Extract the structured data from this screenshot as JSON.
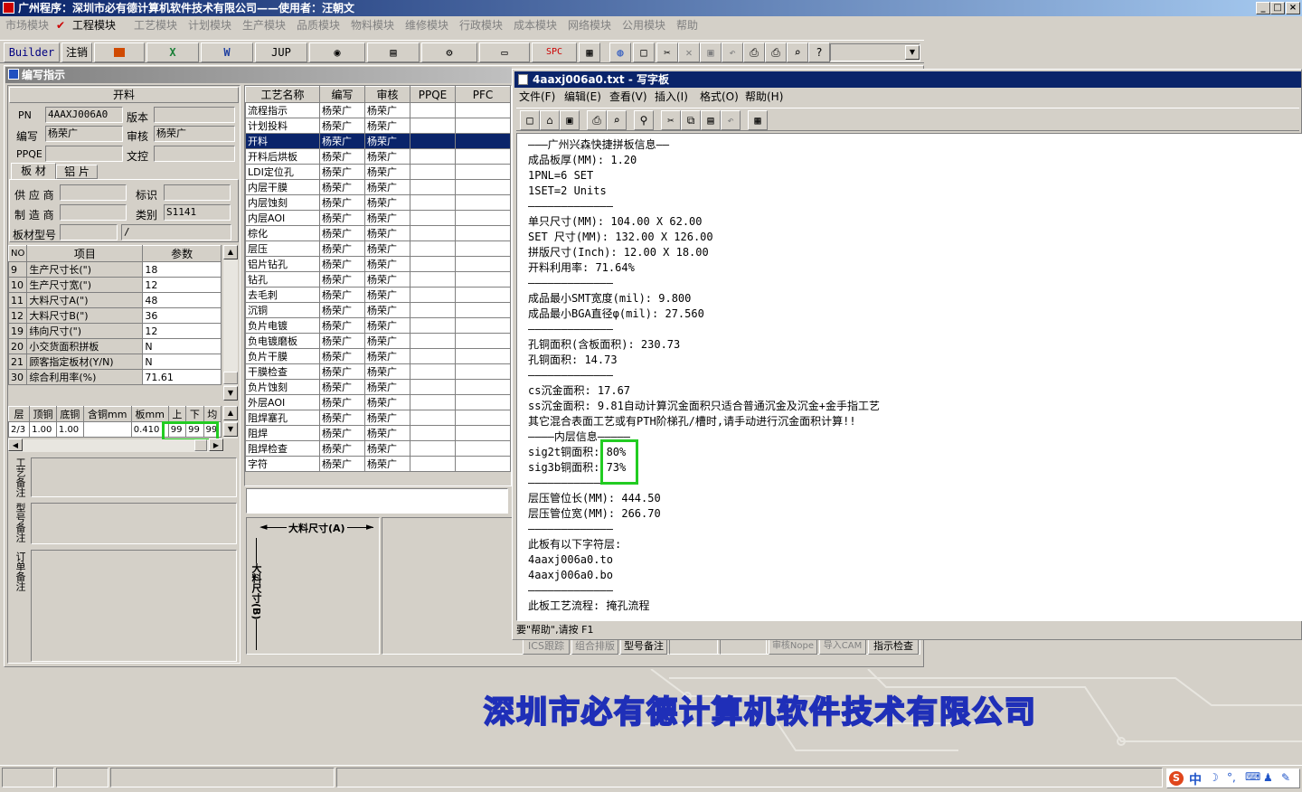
{
  "app": {
    "title": "广州程序：深圳市必有德计算机软件技术有限公司——使用者：汪朝文",
    "menu": [
      "市场模块",
      "工程模块",
      "工艺模块",
      "计划模块",
      "生产模块",
      "品质模块",
      "物料模块",
      "维修模块",
      "行政模块",
      "成本模块",
      "网络模块",
      "公用模块",
      "帮助"
    ],
    "toolbar": {
      "builder": "Builder",
      "logout": "注销",
      "jup": "JUP",
      "spc": "SPC"
    },
    "company_banner": "深圳市必有德计算机软件技术有限公司"
  },
  "editor": {
    "title": "编写指示",
    "section": "开料",
    "fields": {
      "pn_label": "PN",
      "pn": "4AAXJ006A0",
      "version_label": "版本",
      "version": "",
      "writer_label": "编写",
      "writer": "杨荣广",
      "reviewer_label": "审核",
      "reviewer": "杨荣广",
      "ppqe_label": "PPQE",
      "ppqe": "",
      "doc_label": "文控",
      "doc": ""
    },
    "tabs": [
      "板 材",
      "铝 片"
    ],
    "material": {
      "supplier_label": "供 应 商",
      "supplier": "",
      "mark_label": "标识",
      "mark": "",
      "maker_label": "制 造 商",
      "maker": "",
      "category_label": "类别",
      "category": "S1141",
      "model_label": "板材型号",
      "model": "",
      "model2": "/"
    },
    "param_headers": [
      "NO",
      "项目",
      "参数"
    ],
    "params": [
      [
        "9",
        "生产尺寸长(\")",
        "18"
      ],
      [
        "10",
        "生产尺寸宽(\")",
        "12"
      ],
      [
        "11",
        "大料尺寸A(\")",
        "48"
      ],
      [
        "12",
        "大料尺寸B(\")",
        "36"
      ],
      [
        "19",
        "纬向尺寸(\")",
        "12"
      ],
      [
        "20",
        "小交货面积拼板",
        "N"
      ],
      [
        "21",
        "顾客指定板材(Y/N)",
        "N"
      ],
      [
        "30",
        "综合利用率(%)",
        "71.61"
      ]
    ],
    "layer_headers": [
      "层",
      "顶铜",
      "底铜",
      "含铜mm",
      "板mm",
      "上",
      "下",
      "均"
    ],
    "layer_row": [
      "2/3",
      "1.00",
      "1.00",
      "",
      "0.410",
      "99",
      "99",
      "99"
    ],
    "notes": [
      "工艺备注",
      "型号备注",
      "订单备注"
    ]
  },
  "process": {
    "headers": [
      "工艺名称",
      "编写",
      "审核",
      "PPQE",
      "PFC"
    ],
    "rows": [
      [
        "流程指示",
        "杨荣广",
        "杨荣广"
      ],
      [
        "计划投料",
        "杨荣广",
        "杨荣广"
      ],
      [
        "开料",
        "杨荣广",
        "杨荣广"
      ],
      [
        "开料后烘板",
        "杨荣广",
        "杨荣广"
      ],
      [
        "LDI定位孔",
        "杨荣广",
        "杨荣广"
      ],
      [
        "内层干膜",
        "杨荣广",
        "杨荣广"
      ],
      [
        "内层蚀刻",
        "杨荣广",
        "杨荣广"
      ],
      [
        "内层AOI",
        "杨荣广",
        "杨荣广"
      ],
      [
        "棕化",
        "杨荣广",
        "杨荣广"
      ],
      [
        "层压",
        "杨荣广",
        "杨荣广"
      ],
      [
        "铝片钻孔",
        "杨荣广",
        "杨荣广"
      ],
      [
        "钻孔",
        "杨荣广",
        "杨荣广"
      ],
      [
        "去毛刺",
        "杨荣广",
        "杨荣广"
      ],
      [
        "沉铜",
        "杨荣广",
        "杨荣广"
      ],
      [
        "负片电镀",
        "杨荣广",
        "杨荣广"
      ],
      [
        "负电镀磨板",
        "杨荣广",
        "杨荣广"
      ],
      [
        "负片干膜",
        "杨荣广",
        "杨荣广"
      ],
      [
        "干膜检查",
        "杨荣广",
        "杨荣广"
      ],
      [
        "负片蚀刻",
        "杨荣广",
        "杨荣广"
      ],
      [
        "外层AOI",
        "杨荣广",
        "杨荣广"
      ],
      [
        "阻焊塞孔",
        "杨荣广",
        "杨荣广"
      ],
      [
        "阻焊",
        "杨荣广",
        "杨荣广"
      ],
      [
        "阻焊检查",
        "杨荣广",
        "杨荣广"
      ],
      [
        "字符",
        "杨荣广",
        "杨荣广"
      ]
    ],
    "selected_index": 2,
    "dim_a": "大料尺寸(A)",
    "dim_b": "大料尺寸(B)",
    "bottom_buttons": [
      "ICS跟踪",
      "组合排版",
      "型号备注",
      "审核Nope",
      "导入CAM",
      "指示检查"
    ]
  },
  "wordpad": {
    "title": "4aaxj006a0.txt - 写字板",
    "menu": [
      "文件(F)",
      "编辑(E)",
      "查看(V)",
      "插入(I)",
      "格式(O)",
      "帮助(H)"
    ],
    "lines": [
      "———广州兴森快捷拼板信息——",
      "成品板厚(MM): 1.20",
      "1PNL=6 SET",
      "1SET=2 Units",
      "—————————————",
      "单只尺寸(MM): 104.00 X 62.00",
      "SET 尺寸(MM): 132.00 X 126.00",
      "拼版尺寸(Inch): 12.00 X 18.00",
      "开料利用率: 71.64%",
      "—————————————",
      "成品最小SMT宽度(mil): 9.800",
      "成品最小BGA直径φ(mil): 27.560",
      "—————————————",
      "孔铜面积(含板面积): 230.73",
      "孔铜面积: 14.73",
      "—————————————",
      "cs沉金面积: 17.67",
      "ss沉金面积: 9.81自动计算沉金面积只适合普通沉金及沉金+金手指工艺",
      "其它混合表面工艺或有PTH阶梯孔/槽时,请手动进行沉金面积计算!!",
      "————内层信息—————",
      "sig2t铜面积: 80%",
      "sig3b铜面积: 73%",
      "—————————————",
      "层压管位长(MM): 444.50",
      "层压管位宽(MM): 266.70",
      "—————————————",
      "此板有以下字符层:",
      "4aaxj006a0.to",
      "4aaxj006a0.bo",
      "—————————————",
      "此板工艺流程: 掩孔流程"
    ],
    "status": "要\"帮助\",请按 F1"
  },
  "taskbar": {
    "ime": "中"
  }
}
